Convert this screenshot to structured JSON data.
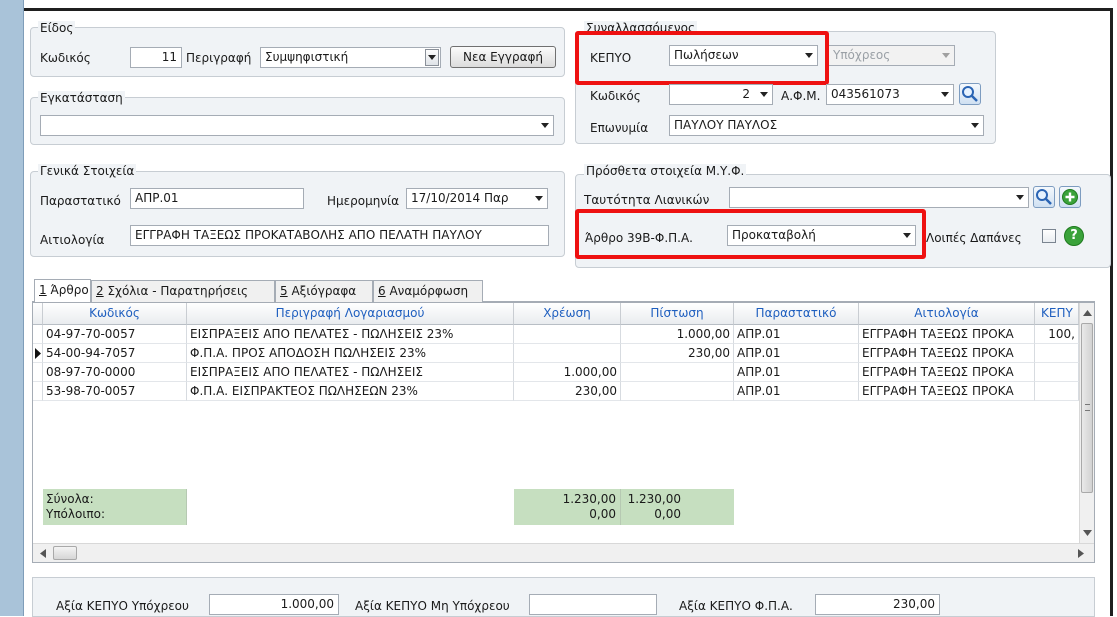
{
  "eidos": {
    "group_title": "Είδος",
    "code_label": "Κωδικός",
    "code_value": "11",
    "desc_label": "Περιγραφή",
    "desc_value": "Συμψηφιστική",
    "new_entry_label": "Νεα Εγγραφή"
  },
  "egkatastasi": {
    "group_title": "Εγκατάσταση",
    "value": ""
  },
  "synallassomenos": {
    "group_title": "Συναλλασσόμενος",
    "kepyo_label": "ΚΕΠΥΟ",
    "kepyo_value": "Πωλήσεων",
    "ypoxreos_value": "Υπόχρεος",
    "code_label": "Κωδικός",
    "code_value": "2",
    "afm_label": "Α.Φ.Μ.",
    "afm_value": "043561073",
    "name_label": "Επωνυμία",
    "name_value": "ΠΑΥΛΟΥ ΠΑΥΛΟΣ"
  },
  "genika": {
    "group_title": "Γενικά Στοιχεία",
    "parastatiko_label": "Παραστατικό",
    "parastatiko_value": "ΑΠΡ.01",
    "date_label": "Ημερομηνία",
    "date_value": "17/10/2014 Παρ",
    "apologia_label": "Αιτιολογία",
    "apologia_value": "ΕΓΓΡΑΦΗ ΤΑΞΕΩΣ ΠΡΟΚΑΤΑΒΟΛΗΣ ΑΠΟ ΠΕΛΑΤΗ ΠΑΥΛΟΥ"
  },
  "myf": {
    "group_title": "Πρόσθετα στοιχεία Μ.Υ.Φ.",
    "tautotita_label": "Ταυτότητα Λιανικών",
    "tautotita_value": "",
    "arthro_label": "Άρθρο 39Β-Φ.Π.Α.",
    "arthro_value": "Προκαταβολή",
    "loipes_label": "Λοιπές Δαπάνες"
  },
  "tabs": [
    {
      "num": "1",
      "label": " Άρθρο"
    },
    {
      "num": "2",
      "label": " Σχόλια - Παρατηρήσεις"
    },
    {
      "num": "5",
      "label": " Αξιόγραφα"
    },
    {
      "num": "6",
      "label": " Αναμόρφωση"
    }
  ],
  "grid": {
    "columns": [
      "Κωδικός",
      "Περιγραφή Λογαριασμού",
      "Χρέωση",
      "Πίστωση",
      "Παραστατικό",
      "Αιτιολογία",
      "ΚΕΠΥ"
    ],
    "rows": [
      {
        "code": "04-97-70-0057",
        "desc": "ΕΙΣΠΡΑΞΕΙΣ ΑΠΟ ΠΕΛΑΤΕΣ - ΠΩΛΗΣΕΙΣ 23%",
        "debit": "",
        "credit": "1.000,00",
        "doc": "ΑΠΡ.01",
        "reason": "ΕΓΓΡΑΦΗ ΤΑΞΕΩΣ ΠΡΟΚΑ",
        "kepy": "100,"
      },
      {
        "code": "54-00-94-7057",
        "desc": "Φ.Π.Α. ΠΡΟΣ ΑΠΟΔΟΣΗ ΠΩΛΗΣΕΙΣ 23%",
        "debit": "",
        "credit": "230,00",
        "doc": "ΑΠΡ.01",
        "reason": "ΕΓΓΡΑΦΗ ΤΑΞΕΩΣ ΠΡΟΚΑ",
        "kepy": ""
      },
      {
        "code": "08-97-70-0000",
        "desc": "ΕΙΣΠΡΑΞΕΙΣ ΑΠΟ ΠΕΛΑΤΕΣ - ΠΩΛΗΣΕΙΣ",
        "debit": "1.000,00",
        "credit": "",
        "doc": "ΑΠΡ.01",
        "reason": "ΕΓΓΡΑΦΗ ΤΑΞΕΩΣ ΠΡΟΚΑ",
        "kepy": ""
      },
      {
        "code": "53-98-70-0057",
        "desc": "Φ.Π.Α. ΕΙΣΠΡΑΚΤΕΟΣ ΠΩΛΗΣΕΩΝ 23%",
        "debit": "230,00",
        "credit": "",
        "doc": "ΑΠΡ.01",
        "reason": "ΕΓΓΡΑΦΗ ΤΑΞΕΩΣ ΠΡΟΚΑ",
        "kepy": ""
      }
    ],
    "totals_label": "Σύνολα:",
    "balance_label": "Υπόλοιπο:",
    "total_debit": "1.230,00",
    "total_credit": "1.230,00",
    "balance_debit": "0,00",
    "balance_credit": "0,00"
  },
  "footer": {
    "ypoxreou_label": "Αξία ΚΕΠΥΟ Υπόχρεου",
    "ypoxreou_value": "1.000,00",
    "mi_ypoxreou_label": "Αξία ΚΕΠΥΟ Μη Υπόχρεου",
    "mi_ypoxreou_value": "",
    "fpa_label": "Αξία ΚΕΠΥΟ Φ.Π.Α.",
    "fpa_value": "230,00"
  },
  "colors": {
    "highlight_red": "#ee1111",
    "totals_green": "#c6dfc0",
    "header_text": "#1f5fbf",
    "help_green": "#3aa23a"
  }
}
